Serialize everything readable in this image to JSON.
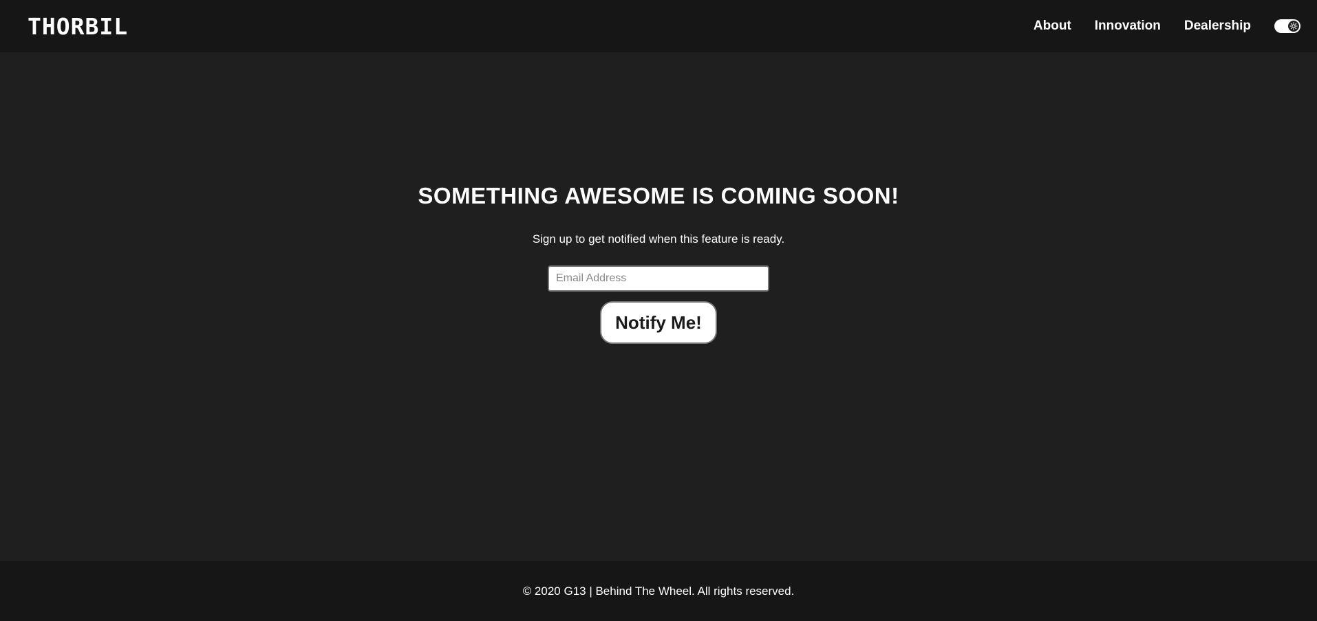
{
  "header": {
    "logo_text": "THORBIL",
    "nav": [
      {
        "label": "About"
      },
      {
        "label": "Innovation"
      },
      {
        "label": "Dealership"
      }
    ],
    "theme_toggle_icon": "sun-icon"
  },
  "main": {
    "headline": "SOMETHING AWESOME IS COMING SOON!",
    "subtext": "Sign up to get notified when this feature is ready.",
    "email_placeholder": "Email Address",
    "email_value": "",
    "button_label": "Notify Me!"
  },
  "footer": {
    "text": "© 2020 G13 | Behind The Wheel. All rights reserved."
  },
  "colors": {
    "header_bg": "#161616",
    "page_bg": "#1f1f1f",
    "text": "#ffffff",
    "button_bg": "#ffffff"
  }
}
